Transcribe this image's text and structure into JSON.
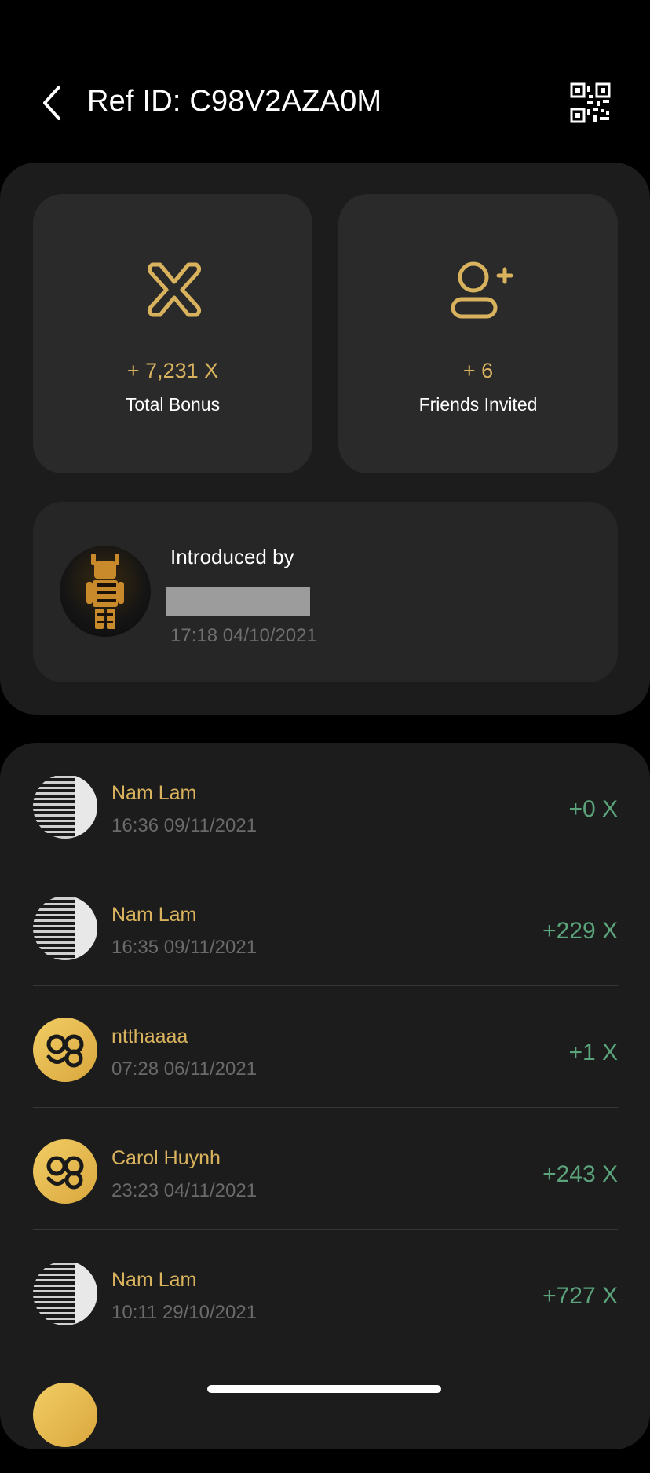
{
  "header": {
    "title": "Ref ID: C98V2AZA0M",
    "back_icon": "chevron-left-icon",
    "qr_icon": "qr-code-icon"
  },
  "stats": {
    "total_bonus": {
      "value": "+ 7,231 X",
      "label": "Total Bonus",
      "icon": "x-token-icon"
    },
    "friends_invited": {
      "value": "+ 6",
      "label": "Friends Invited",
      "icon": "add-user-icon"
    }
  },
  "introduced": {
    "label": "Introduced by",
    "time": "17:18 04/10/2021"
  },
  "referrals": [
    {
      "name": "Nam Lam",
      "time": "16:36 09/11/2021",
      "amount": "+0 X",
      "avatar": "photo"
    },
    {
      "name": "Nam Lam",
      "time": "16:35 09/11/2021",
      "amount": "+229 X",
      "avatar": "photo"
    },
    {
      "name": "ntthaaaa",
      "time": "07:28 06/11/2021",
      "amount": "+1 X",
      "avatar": "logo"
    },
    {
      "name": "Carol Huynh",
      "time": "23:23 04/11/2021",
      "amount": "+243 X",
      "avatar": "logo"
    },
    {
      "name": "Nam Lam",
      "time": "10:11 29/10/2021",
      "amount": "+727 X",
      "avatar": "photo"
    }
  ],
  "colors": {
    "gold": "#d9b25d",
    "green": "#5aa37b",
    "card": "#1c1c1c",
    "tile": "#2a2a2a"
  }
}
